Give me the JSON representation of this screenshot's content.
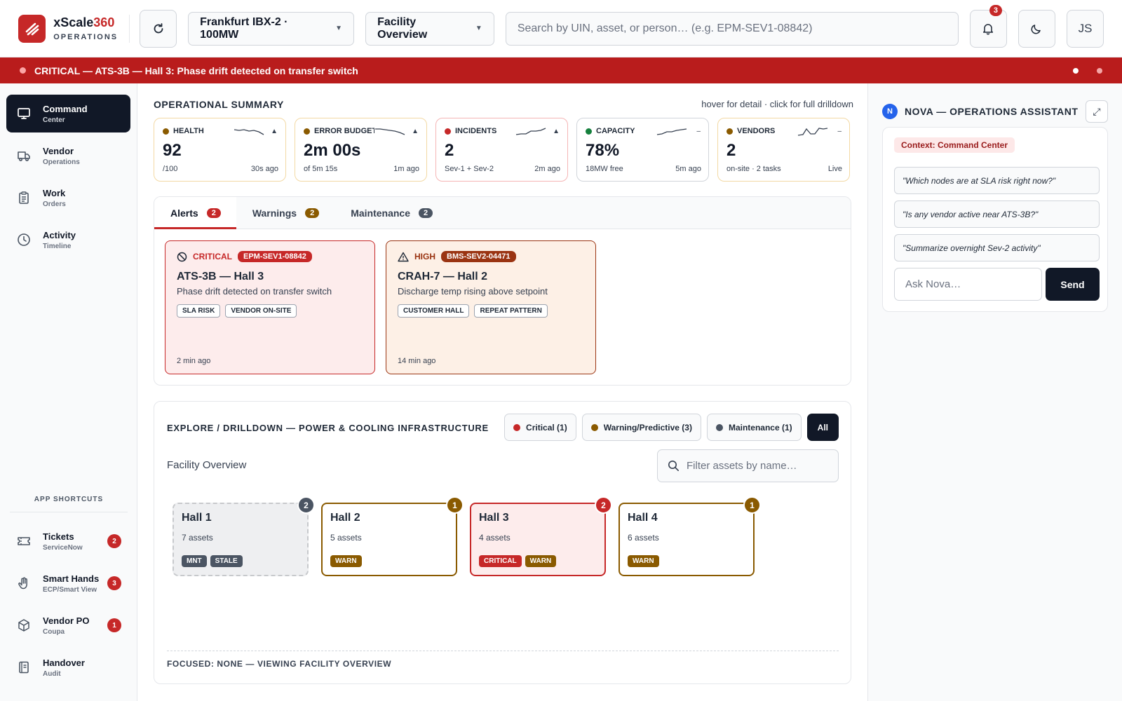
{
  "header": {
    "brand_name": "xScale",
    "brand_num": "360",
    "brand_sub": "OPERATIONS",
    "site_selector": "Frankfurt IBX-2 · 100MW",
    "view_selector": "Facility Overview",
    "search_placeholder": "Search by UIN, asset, or person… (e.g. EPM-SEV1-08842)",
    "notification_count": "3",
    "user_initials": "JS"
  },
  "banner": {
    "text": "CRITICAL — ATS-3B — Hall 3: Phase drift detected on transfer switch"
  },
  "sidebar": {
    "items": [
      {
        "title": "Command",
        "sub": "Center",
        "icon": "monitor-icon"
      },
      {
        "title": "Vendor",
        "sub": "Operations",
        "icon": "truck-icon"
      },
      {
        "title": "Work",
        "sub": "Orders",
        "icon": "clipboard-icon"
      },
      {
        "title": "Activity",
        "sub": "Timeline",
        "icon": "clock-icon"
      }
    ],
    "shortcuts_title": "APP SHORTCUTS",
    "shortcuts": [
      {
        "title": "Tickets",
        "sub": "ServiceNow",
        "count": "2",
        "icon": "ticket-icon"
      },
      {
        "title": "Smart Hands",
        "sub": "ECP/Smart View",
        "count": "3",
        "icon": "hand-icon"
      },
      {
        "title": "Vendor PO",
        "sub": "Coupa",
        "count": "1",
        "icon": "box-icon"
      },
      {
        "title": "Handover",
        "sub": "Audit",
        "icon": "notebook-icon"
      }
    ]
  },
  "summary": {
    "title": "OPERATIONAL SUMMARY",
    "hint": "hover for detail · click for full drilldown",
    "kpis": [
      {
        "label": "HEALTH",
        "value": "92",
        "sub": "/100",
        "ago": "30s ago",
        "trend": "▲",
        "color": "#8a5a00",
        "border": "#f3d9a4"
      },
      {
        "label": "ERROR BUDGET",
        "value": "2m 00s",
        "sub": "of 5m 15s",
        "ago": "1m ago",
        "trend": "▲",
        "color": "#8a5a00",
        "border": "#f3d9a4"
      },
      {
        "label": "INCIDENTS",
        "value": "2",
        "sub": "Sev-1 + Sev-2",
        "ago": "2m ago",
        "trend": "▲",
        "color": "#c62828",
        "border": "#f5b5b5"
      },
      {
        "label": "CAPACITY",
        "value": "78%",
        "sub": "18MW free",
        "ago": "5m ago",
        "trend": "–",
        "color": "#15803d",
        "border": "#d1d5db"
      },
      {
        "label": "VENDORS",
        "value": "2",
        "sub": "on-site · 2 tasks",
        "ago": "Live",
        "trend": "–",
        "color": "#8a5a00",
        "border": "#f3d9a4"
      }
    ]
  },
  "tabs": [
    {
      "label": "Alerts",
      "count": "2",
      "color": "#c62828"
    },
    {
      "label": "Warnings",
      "count": "2",
      "color": "#8a5a00"
    },
    {
      "label": "Maintenance",
      "count": "2",
      "color": "#4b5563"
    }
  ],
  "alerts": [
    {
      "severity": "CRITICAL",
      "code": "EPM-SEV1-08842",
      "title": "ATS-3B — Hall 3",
      "desc": "Phase drift detected on transfer switch",
      "tags": [
        "SLA RISK",
        "VENDOR ON-SITE"
      ],
      "time": "2 min ago",
      "color": "#c62828",
      "bg": "#fdecec",
      "icon": "block-icon"
    },
    {
      "severity": "HIGH",
      "code": "BMS-SEV2-04471",
      "title": "CRAH-7 — Hall 2",
      "desc": "Discharge temp rising above setpoint",
      "tags": [
        "CUSTOMER HALL",
        "REPEAT PATTERN"
      ],
      "time": "14 min ago",
      "color": "#9a3412",
      "bg": "#fdf0e6",
      "icon": "warning-icon"
    }
  ],
  "explore": {
    "title": "EXPLORE / DRILLDOWN — POWER & COOLING INFRASTRUCTURE",
    "filters": [
      {
        "label": "Critical (1)",
        "color": "#c62828"
      },
      {
        "label": "Warning/Predictive (3)",
        "color": "#8a5a00"
      },
      {
        "label": "Maintenance (1)",
        "color": "#4b5563"
      }
    ],
    "all_label": "All",
    "facility_label": "Facility Overview",
    "filter_placeholder": "Filter assets by name…",
    "halls": [
      {
        "name": "Hall 1",
        "assets": "7 assets",
        "count": "2",
        "chips": [
          "MNT",
          "STALE"
        ]
      },
      {
        "name": "Hall 2",
        "assets": "5 assets",
        "count": "1",
        "chips": [
          "WARN"
        ]
      },
      {
        "name": "Hall 3",
        "assets": "4 assets",
        "count": "2",
        "chips": [
          "CRITICAL",
          "WARN"
        ]
      },
      {
        "name": "Hall 4",
        "assets": "6 assets",
        "count": "1",
        "chips": [
          "WARN"
        ]
      }
    ],
    "focus_text": "FOCUSED: NONE — VIEWING FACILITY OVERVIEW"
  },
  "assistant": {
    "avatar": "N",
    "title": "NOVA — OPERATIONS ASSISTANT",
    "expand_icon": "⤢",
    "context": "Context: Command Center",
    "suggestions": [
      "\"Which nodes are at SLA risk right now?\"",
      "\"Is any vendor active near ATS-3B?\"",
      "\"Summarize overnight Sev-2 activity\""
    ],
    "ask_placeholder": "Ask Nova…",
    "send_label": "Send"
  }
}
